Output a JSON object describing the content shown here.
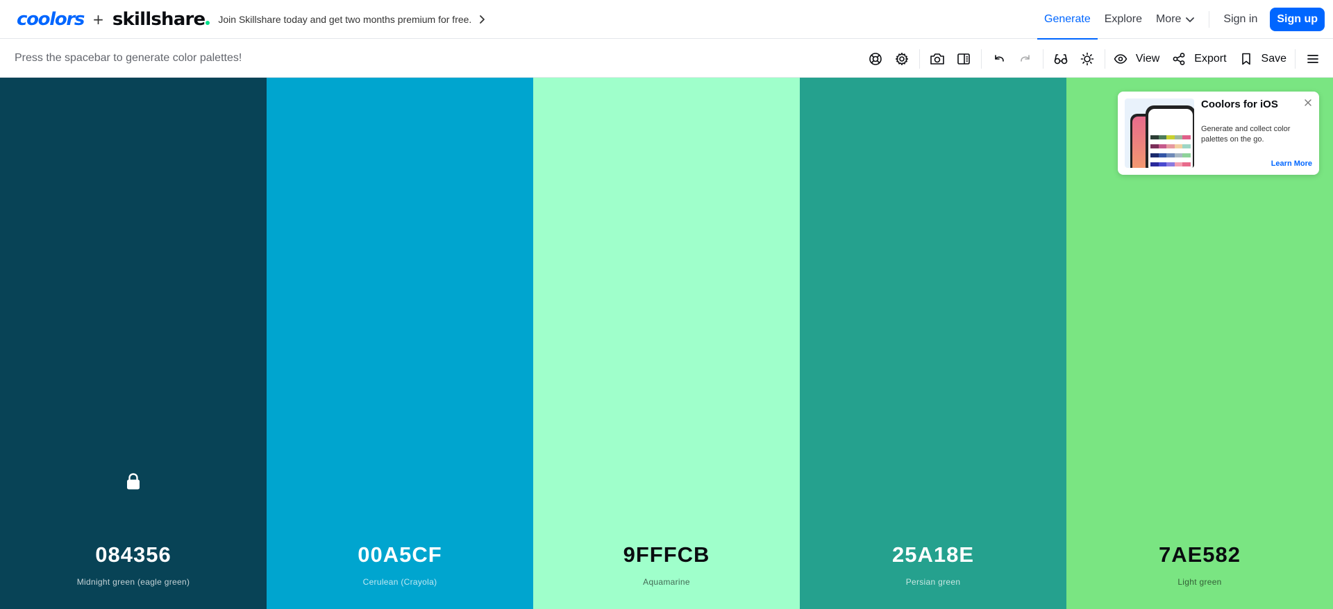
{
  "header": {
    "brand_coolors": "coolors",
    "brand_plus": "+",
    "brand_partner": "skillshare",
    "promo_text": "Join Skillshare today and get two months premium for free.",
    "nav": {
      "generate": "Generate",
      "explore": "Explore",
      "more": "More",
      "sign_in": "Sign in",
      "sign_up": "Sign up"
    }
  },
  "toolbar": {
    "hint": "Press the spacebar to generate color palettes!",
    "icons": [
      "help-icon",
      "settings-icon",
      "camera-icon",
      "side-panel-icon",
      "undo-icon",
      "redo-icon",
      "glasses-icon",
      "sun-icon",
      "eye-icon",
      "share-icon",
      "bookmark-icon",
      "hamburger-menu-icon"
    ],
    "view_label": "View",
    "export_label": "Export",
    "save_label": "Save"
  },
  "palette": [
    {
      "hex": "084356",
      "name": "Midnight green (eagle green)",
      "color": "#084356",
      "text": "light",
      "show_lock": true
    },
    {
      "hex": "00A5CF",
      "name": "Cerulean (Crayola)",
      "color": "#00A5CF",
      "text": "light",
      "show_lock": false
    },
    {
      "hex": "9FFFCB",
      "name": "Aquamarine",
      "color": "#9FFFCB",
      "text": "dark",
      "show_lock": false
    },
    {
      "hex": "25A18E",
      "name": "Persian green",
      "color": "#25A18E",
      "text": "light",
      "show_lock": false
    },
    {
      "hex": "7AE582",
      "name": "Light green",
      "color": "#7AE582",
      "text": "dark",
      "show_lock": false
    }
  ],
  "ios_card": {
    "title": "Coolors for iOS",
    "description": "Generate and collect color palettes on the go.",
    "link": "Learn More"
  },
  "colors": {
    "accent": "#0066FF",
    "skillshare_dot": "#00E08A"
  }
}
